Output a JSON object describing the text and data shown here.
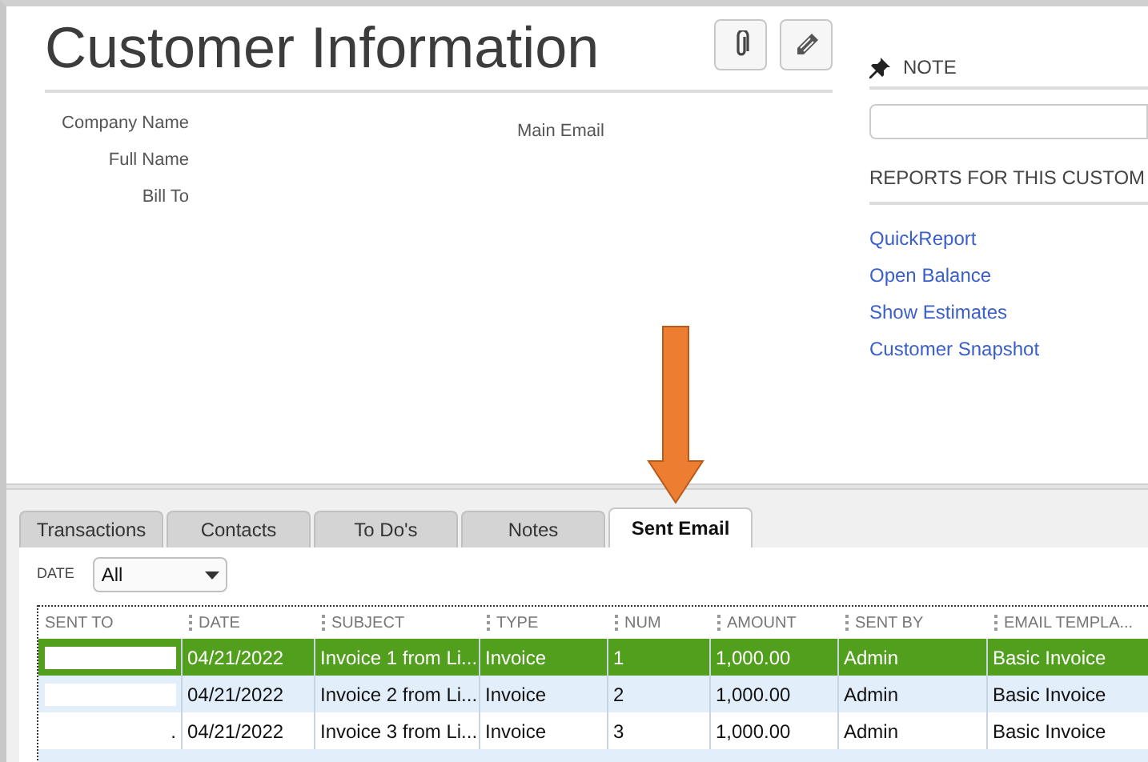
{
  "title": "Customer Information",
  "fields": [
    {
      "label": "Company Name"
    },
    {
      "label": "Full Name"
    },
    {
      "label": "Bill To"
    }
  ],
  "main_email": {
    "label": "Main Email"
  },
  "note": {
    "label": "NOTE"
  },
  "reports": {
    "heading": "REPORTS FOR THIS CUSTOM",
    "links": [
      "QuickReport",
      "Open Balance",
      "Show Estimates",
      "Customer Snapshot"
    ]
  },
  "tabs": [
    {
      "label": "Transactions",
      "selected": false
    },
    {
      "label": "Contacts",
      "selected": false
    },
    {
      "label": "To Do's",
      "selected": false
    },
    {
      "label": "Notes",
      "selected": false
    },
    {
      "label": "Sent Email",
      "selected": true
    }
  ],
  "filter": {
    "label": "DATE",
    "value": "All"
  },
  "table": {
    "columns": [
      "SENT TO",
      "DATE",
      "SUBJECT",
      "TYPE",
      "NUM",
      "AMOUNT",
      "SENT BY",
      "EMAIL TEMPLA..."
    ],
    "rows": [
      {
        "selected": true,
        "masked": true,
        "cells": [
          "",
          "04/21/2022",
          "Invoice 1 from Li...",
          "Invoice",
          "1",
          "1,000.00",
          "Admin",
          "Basic Invoice"
        ]
      },
      {
        "selected": false,
        "masked": true,
        "cells": [
          "",
          "04/21/2022",
          "Invoice 2 from Li...",
          "Invoice",
          "2",
          "1,000.00",
          "Admin",
          "Basic Invoice"
        ]
      },
      {
        "selected": false,
        "masked": false,
        "cells": [
          ".",
          "04/21/2022",
          "Invoice 3 from Li...",
          "Invoice",
          "3",
          "1,000.00",
          "Admin",
          "Basic Invoice"
        ]
      }
    ]
  }
}
